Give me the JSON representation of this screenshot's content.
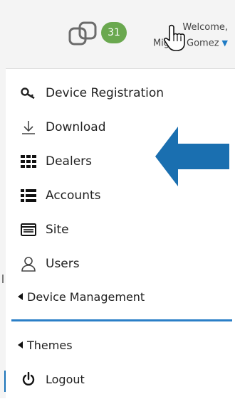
{
  "header": {
    "badge_count": "31",
    "welcome_line1": "Welcome,",
    "welcome_line2": "Miguel Gomez"
  },
  "menu": {
    "items": [
      {
        "label": "Device Registration",
        "icon": "key-icon"
      },
      {
        "label": "Download",
        "icon": "download-icon"
      },
      {
        "label": "Dealers",
        "icon": "grid-icon"
      },
      {
        "label": "Accounts",
        "icon": "list-icon"
      },
      {
        "label": "Site",
        "icon": "window-icon"
      },
      {
        "label": "Users",
        "icon": "user-icon"
      },
      {
        "label": "Device Management",
        "icon": "caret-left-icon"
      },
      {
        "label": "Themes",
        "icon": "caret-left-icon"
      },
      {
        "label": "Logout",
        "icon": "power-icon"
      }
    ]
  },
  "colors": {
    "accent": "#2b7fc7",
    "badge": "#6aa84f",
    "arrow": "#1a6fb0"
  }
}
